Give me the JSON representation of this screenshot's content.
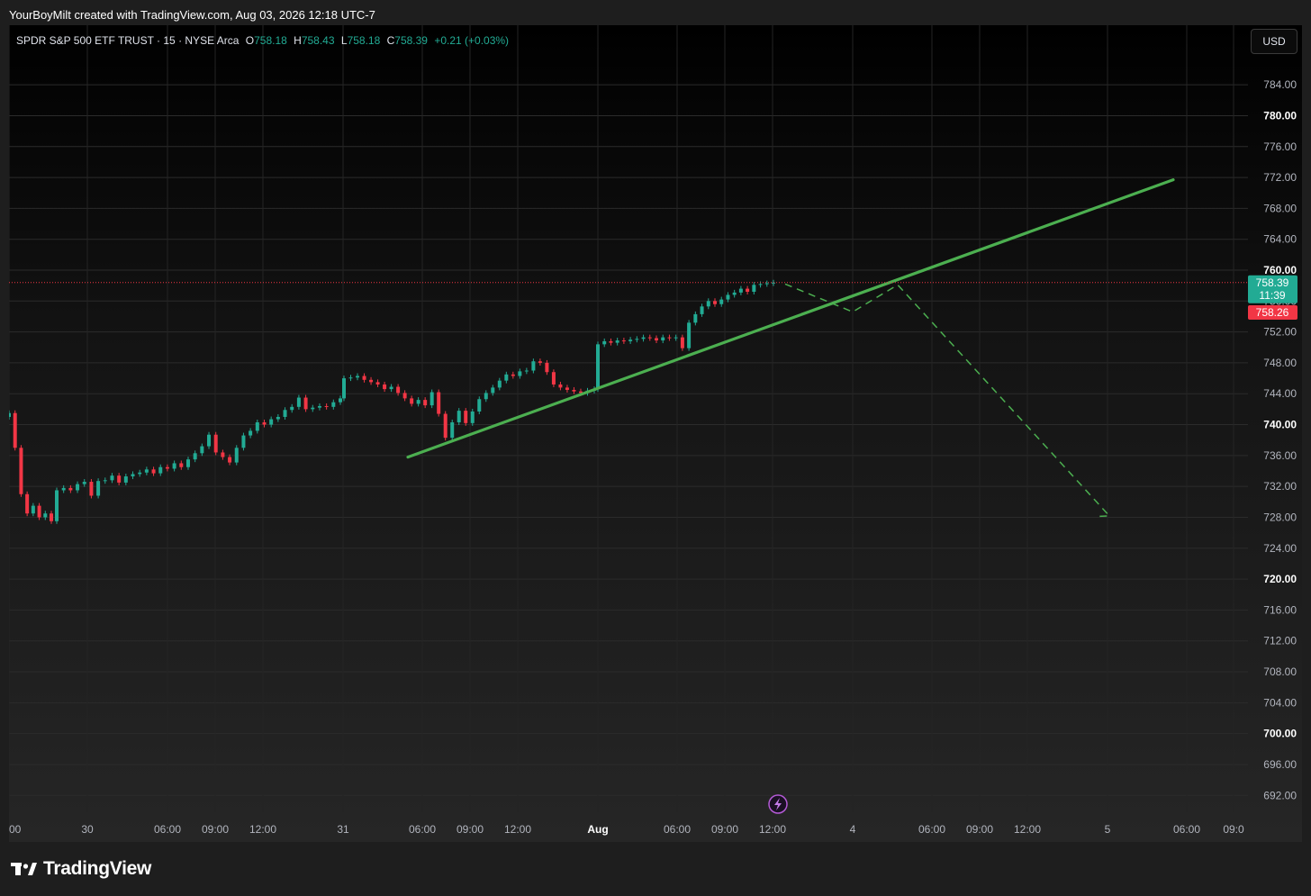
{
  "header": {
    "credit": "YourBoyMilt created with TradingView.com, Aug 03, 2026 12:18 UTC-7"
  },
  "legend": {
    "symbol": "SPDR S&P 500 ETF TRUST · 15 · NYSE Arca",
    "o_label": "O",
    "o_value": "758.18",
    "h_label": "H",
    "h_value": "758.43",
    "l_label": "L",
    "l_value": "758.18",
    "c_label": "C",
    "c_value": "758.39",
    "change": "+0.21 (+0.03%)"
  },
  "currency_button": "USD",
  "footer": {
    "brand": "TradingView"
  },
  "chart_data": {
    "type": "candlestick",
    "timeframe": "15",
    "ylim": [
      688,
      788
    ],
    "y_ticks": [
      "784.00",
      "780.00",
      "776.00",
      "772.00",
      "768.00",
      "764.00",
      "760.00",
      "756.00",
      "752.00",
      "748.00",
      "744.00",
      "740.00",
      "736.00",
      "732.00",
      "728.00",
      "724.00",
      "720.00",
      "716.00",
      "712.00",
      "708.00",
      "704.00",
      "700.00",
      "696.00",
      "692.00"
    ],
    "bold_y_ticks": [
      "780.00",
      "760.00",
      "740.00",
      "720.00",
      "700.00"
    ],
    "x_ticks": [
      "00",
      "30",
      "06:00",
      "09:00",
      "12:00",
      "31",
      "06:00",
      "09:00",
      "12:00",
      "Aug",
      "06:00",
      "09:00",
      "12:00",
      "4",
      "06:00",
      "09:00",
      "12:00",
      "5",
      "06:00",
      "09:0"
    ],
    "bold_x_ticks": [
      "Aug"
    ],
    "price_labels": {
      "last": "758.39",
      "countdown": "11:39",
      "prev_close": "758.26"
    },
    "colors": {
      "up": "#22ab94",
      "down": "#f23645",
      "trendline": "#4caf50",
      "projection": "#4caf50",
      "last_price_bg": "#22ab94",
      "prev_close_bg": "#f23645"
    },
    "price_path": [
      [
        0,
        741.5
      ],
      [
        1,
        737
      ],
      [
        2,
        731
      ],
      [
        3,
        728.5
      ],
      [
        4,
        729.5
      ],
      [
        5,
        728
      ],
      [
        6,
        728.5
      ],
      [
        7,
        727.5
      ],
      [
        8,
        731.5
      ],
      [
        9,
        731.8
      ],
      [
        10,
        731.5
      ],
      [
        11,
        732.3
      ],
      [
        12,
        732.6
      ],
      [
        13,
        730.8
      ],
      [
        14,
        732.7
      ],
      [
        15,
        732.8
      ],
      [
        16,
        733.4
      ],
      [
        17,
        732.5
      ],
      [
        18,
        733.3
      ],
      [
        19,
        733.6
      ],
      [
        20,
        733.8
      ],
      [
        21,
        734.2
      ],
      [
        22,
        733.7
      ],
      [
        23,
        734.5
      ],
      [
        24,
        734.3
      ],
      [
        25,
        735
      ],
      [
        26,
        734.5
      ],
      [
        27,
        735.5
      ],
      [
        28,
        736.3
      ],
      [
        29,
        737.2
      ],
      [
        30,
        738.7
      ],
      [
        31,
        736.4
      ],
      [
        32,
        735.8
      ],
      [
        33,
        735.1
      ],
      [
        34,
        737
      ],
      [
        35,
        738.6
      ],
      [
        36,
        739.2
      ],
      [
        37,
        740.3
      ],
      [
        38,
        740
      ],
      [
        39,
        740.7
      ],
      [
        40,
        741
      ],
      [
        41,
        741.9
      ],
      [
        42,
        742.3
      ],
      [
        43,
        743.5
      ],
      [
        44,
        742
      ],
      [
        45,
        742.2
      ],
      [
        46,
        742.4
      ],
      [
        47,
        742.3
      ],
      [
        48,
        742.9
      ],
      [
        49,
        743.4
      ],
      [
        50,
        746
      ],
      [
        51,
        746.1
      ],
      [
        52,
        746.3
      ],
      [
        53,
        745.8
      ],
      [
        54,
        745.5
      ],
      [
        55,
        745.2
      ],
      [
        56,
        744.6
      ],
      [
        57,
        744.9
      ],
      [
        58,
        744.1
      ],
      [
        59,
        743.4
      ],
      [
        60,
        742.7
      ],
      [
        61,
        743.2
      ],
      [
        62,
        742.5
      ],
      [
        63,
        744.2
      ],
      [
        64,
        741.4
      ],
      [
        65,
        738.3
      ],
      [
        66,
        740.3
      ],
      [
        67,
        741.8
      ],
      [
        68,
        740.2
      ],
      [
        69,
        741.7
      ],
      [
        70,
        743.3
      ],
      [
        71,
        744.1
      ],
      [
        72,
        744.8
      ],
      [
        73,
        745.7
      ],
      [
        74,
        746.5
      ],
      [
        75,
        746.3
      ],
      [
        76,
        746.9
      ],
      [
        77,
        747
      ],
      [
        78,
        748.2
      ],
      [
        79,
        748
      ],
      [
        80,
        746.8
      ],
      [
        81,
        745.2
      ],
      [
        82,
        744.8
      ],
      [
        83,
        744.5
      ],
      [
        84,
        744.3
      ],
      [
        85,
        744.1
      ],
      [
        86,
        744.4
      ],
      [
        87,
        744.6
      ],
      [
        88,
        750.4
      ],
      [
        89,
        750.8
      ],
      [
        90,
        750.6
      ],
      [
        91,
        750.9
      ],
      [
        92,
        750.8
      ],
      [
        93,
        751
      ],
      [
        94,
        751.1
      ],
      [
        95,
        751.3
      ],
      [
        96,
        751.2
      ],
      [
        97,
        750.9
      ],
      [
        98,
        751.3
      ],
      [
        99,
        751.2
      ],
      [
        100,
        751.3
      ],
      [
        101,
        749.9
      ],
      [
        102,
        753.2
      ],
      [
        103,
        754.3
      ],
      [
        104,
        755.3
      ],
      [
        105,
        756
      ],
      [
        106,
        755.6
      ],
      [
        107,
        756.2
      ],
      [
        108,
        756.8
      ],
      [
        109,
        757.1
      ],
      [
        110,
        757.6
      ],
      [
        111,
        757.2
      ],
      [
        112,
        758.1
      ],
      [
        113,
        758.2
      ],
      [
        114,
        758.3
      ],
      [
        115,
        758.39
      ]
    ],
    "drawings": {
      "trendline": {
        "from": [
          "30 Jul 06:00",
          735.8
        ],
        "to": [
          "5 Aug 05:00",
          771.7
        ]
      },
      "projection": [
        [
          "3 Aug 12:00",
          758.2
        ],
        [
          "4 Aug 00:00",
          754.6
        ],
        [
          "4 Aug 03:00",
          758.1
        ],
        [
          "5 Aug 00:00",
          728.2
        ],
        [
          "4 Aug 23:30",
          728.1
        ]
      ]
    }
  }
}
